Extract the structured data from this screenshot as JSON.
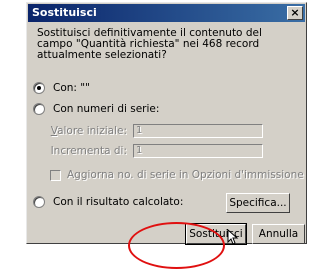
{
  "dialog": {
    "title": "Sostituisci",
    "close_glyph": "×",
    "description": "Sostituisci definitivamente il contenuto del campo \"Quantità richiesta\" nei 468 record attualmente selezionati?",
    "options": {
      "con": {
        "label": "Con: \"\"",
        "selected": true
      },
      "serie": {
        "label": "Con numeri di serie:",
        "selected": false
      },
      "calcolato": {
        "label": "Con il risultato calcolato:",
        "selected": false
      }
    },
    "serie_fields": {
      "valore_iniziale": {
        "label_underlined": "V",
        "label_rest": "alore iniziale:",
        "value": "1"
      },
      "incrementa": {
        "label_prefix": "Incrementa di:",
        "value": "1"
      },
      "aggiorna": {
        "label": "Aggiorna no. di serie in Opzioni d'immissione",
        "checked": false
      }
    },
    "buttons": {
      "specifica": "Specifica...",
      "sostituisci": "Sostituisci",
      "annulla": "Annulla"
    }
  },
  "annotation": {
    "color": "#e01010"
  }
}
